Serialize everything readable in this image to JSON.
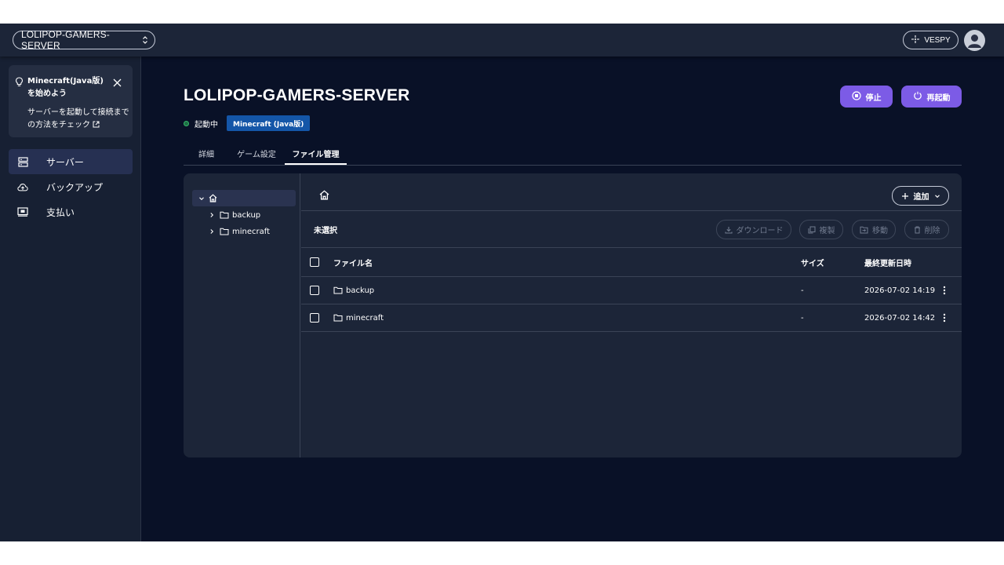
{
  "topbar": {
    "server_name": "LOLIPOP-GAMERS-SERVER",
    "vespy_label": "VESPY"
  },
  "sidebar": {
    "tip": {
      "title": "Minecraft(Java版)を始めよう",
      "body": "サーバーを起動して接続までの方法をチェック"
    },
    "items": [
      {
        "label": "サーバー",
        "icon": "server-icon",
        "active": true
      },
      {
        "label": "バックアップ",
        "icon": "cloud-upload-icon",
        "active": false
      },
      {
        "label": "支払い",
        "icon": "payment-icon",
        "active": false
      }
    ]
  },
  "main": {
    "title": "LOLIPOP-GAMERS-SERVER",
    "status": "起動中",
    "game_badge": "Minecraft (Java版)",
    "stop_label": "停止",
    "restart_label": "再起動",
    "tabs": [
      {
        "label": "詳細",
        "active": false
      },
      {
        "label": "ゲーム設定",
        "active": false
      },
      {
        "label": "ファイル管理",
        "active": true
      }
    ]
  },
  "file_manager": {
    "tree": {
      "children": [
        "backup",
        "minecraft"
      ]
    },
    "add_label": "追加",
    "selection_label": "未選択",
    "actions": {
      "download": "ダウンロード",
      "copy": "複製",
      "move": "移動",
      "delete": "削除"
    },
    "columns": {
      "name": "ファイル名",
      "size": "サイズ",
      "modified": "最終更新日時"
    },
    "rows": [
      {
        "name": "backup",
        "size": "-",
        "modified": "2026-07-02 14:19"
      },
      {
        "name": "minecraft",
        "size": "-",
        "modified": "2026-07-02 14:42"
      }
    ]
  },
  "colors": {
    "background": "#091127",
    "surface": "#1c2538",
    "accent": "#7c5be6",
    "badge": "#1456a8",
    "status_ok": "#35b66a"
  }
}
